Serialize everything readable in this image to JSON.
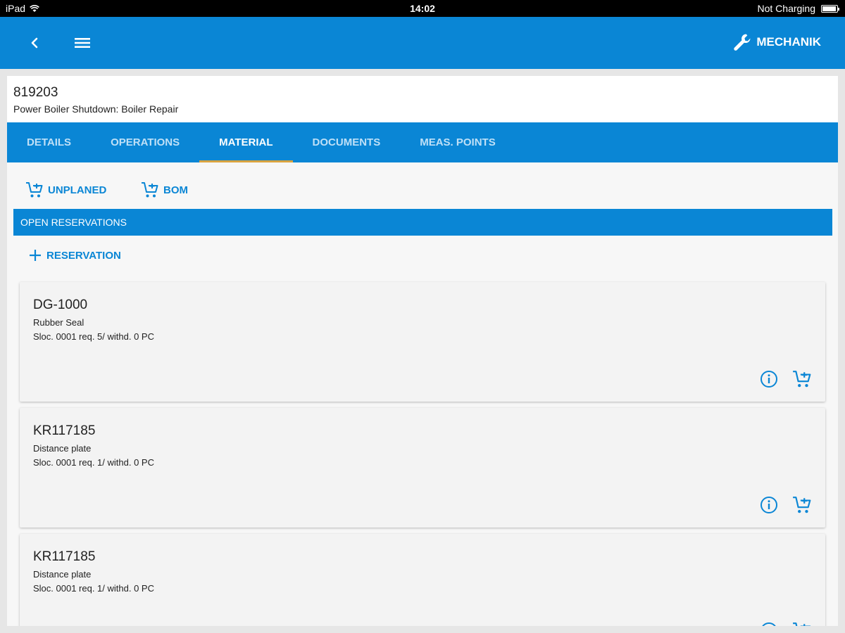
{
  "status_bar": {
    "device": "iPad",
    "time": "14:02",
    "charging": "Not Charging"
  },
  "app_bar": {
    "role_label": "MECHANIK"
  },
  "order": {
    "number": "819203",
    "description": "Power Boiler Shutdown: Boiler Repair"
  },
  "tabs": [
    {
      "label": "DETAILS"
    },
    {
      "label": "OPERATIONS"
    },
    {
      "label": "MATERIAL"
    },
    {
      "label": "DOCUMENTS"
    },
    {
      "label": "MEAS. POINTS"
    }
  ],
  "active_tab": "MATERIAL",
  "actions": {
    "unplaned": "UNPLANED",
    "bom": "BOM",
    "reservation": "RESERVATION"
  },
  "section_title": "OPEN RESERVATIONS",
  "reservations": [
    {
      "id": "DG-1000",
      "name": "Rubber Seal",
      "qty": "Sloc. 0001 req. 5/ withd. 0 PC"
    },
    {
      "id": "KR117185",
      "name": "Distance plate",
      "qty": "Sloc. 0001 req. 1/ withd. 0 PC"
    },
    {
      "id": "KR117185",
      "name": "Distance plate",
      "qty": "Sloc. 0001 req. 1/ withd. 0 PC"
    }
  ],
  "colors": {
    "primary": "#0a86d5",
    "tab_indicator": "#d9a441",
    "inactive_tab": "#bfe0f7"
  }
}
